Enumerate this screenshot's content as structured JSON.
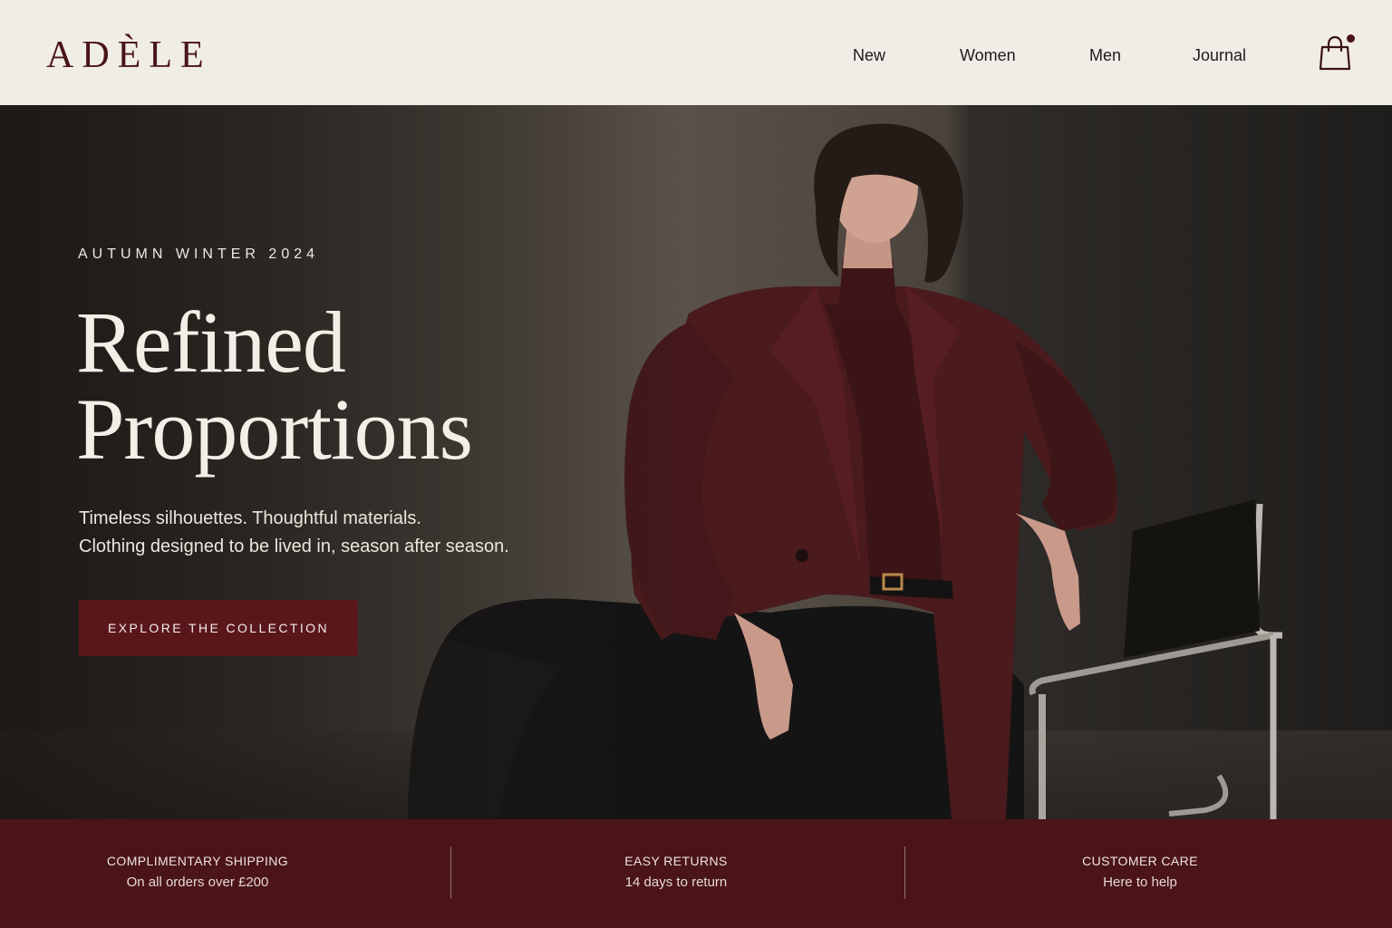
{
  "brand": {
    "name": "ADÈLE",
    "color": "#4a1417"
  },
  "nav": {
    "items": [
      {
        "label": "New"
      },
      {
        "label": "Women"
      },
      {
        "label": "Men"
      },
      {
        "label": "Journal"
      }
    ],
    "cart_icon": "shopping-bag-icon",
    "cart_has_items": true
  },
  "hero": {
    "eyebrow": "AUTUMN WINTER 2024",
    "headline_line1": "Refined",
    "headline_line2": "Proportions",
    "subtext_line1": "Timeless silhouettes. Thoughtful materials.",
    "subtext_line2": "Clothing designed to be lived in, season after season.",
    "cta_label": "EXPLORE THE COLLECTION",
    "cta_color": "#5a171b"
  },
  "perks": [
    {
      "title": "COMPLIMENTARY SHIPPING",
      "subtitle": "On all orders over £200"
    },
    {
      "title": "EASY RETURNS",
      "subtitle": "14 days to return"
    },
    {
      "title": "CUSTOMER CARE",
      "subtitle": "Here to help"
    }
  ],
  "perks_bar_color": "#4a1418"
}
